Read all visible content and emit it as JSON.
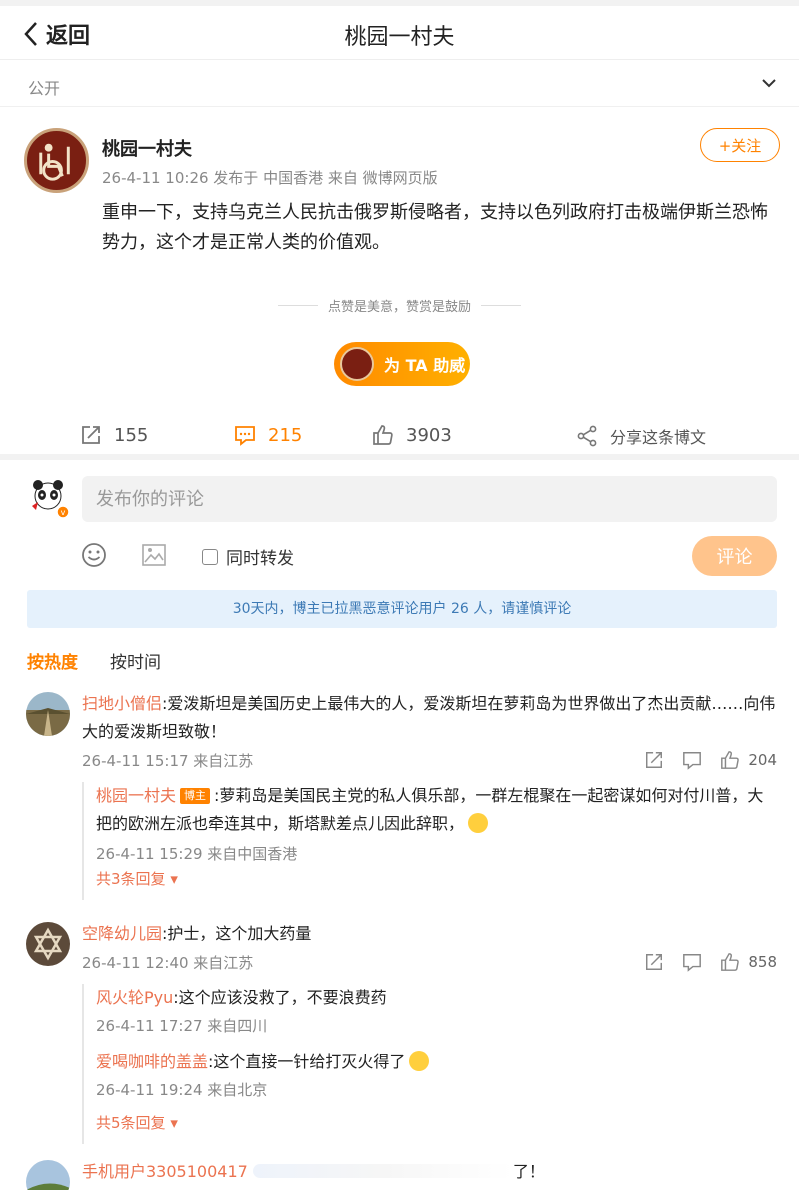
{
  "header": {
    "back_label": "返回",
    "title": "桃园一村夫"
  },
  "visibility": {
    "label": "公开"
  },
  "post": {
    "author": "桃园一村夫",
    "meta": "26-4-11 10:26 发布于 中国香港  来自 微博网页版",
    "follow_label": "+关注",
    "text": "重申一下，支持乌克兰人民抗击俄罗斯侵略者，支持以色列政府打击极端伊斯兰恐怖势力，这个才是正常人类的价值观。",
    "reward_tip": "点赞是美意，赞赏是鼓励",
    "reward_button": "为 TA 助威"
  },
  "actions": {
    "reposts": "155",
    "comments": "215",
    "likes": "3903",
    "share": "分享这条博文"
  },
  "composer": {
    "placeholder": "发布你的评论",
    "repost_label": "同时转发",
    "submit_label": "评论"
  },
  "notice": "30天内，博主已拉黑恶意评论用户 26 人，请谨慎评论",
  "sort": {
    "hot": "按热度",
    "time": "按时间"
  },
  "comments": [
    {
      "user": "扫地小僧侣",
      "text": ":爱泼斯坦是美国历史上最伟大的人，爱泼斯坦在萝莉岛为世界做出了杰出贡献……向伟大的爱泼斯坦致敬！",
      "time": "26-4-11 15:17 来自江苏",
      "likes": "204",
      "replies": [
        {
          "user": "桃园一村夫",
          "badge": "博主",
          "text": ":萝莉岛是美国民主党的私人俱乐部，一群左棍聚在一起密谋如何对付川普，大把的欧洲左派也牵连其中，斯塔默差点儿因此辞职，",
          "time": "26-4-11 15:29 来自中国香港"
        }
      ],
      "more": "共3条回复"
    },
    {
      "user": "空降幼儿园",
      "text": ":护士，这个加大药量",
      "time": "26-4-11 12:40 来自江苏",
      "likes": "858",
      "replies": [
        {
          "user": "风火轮Pyu",
          "text": ":这个应该没救了，不要浪费药",
          "time": "26-4-11 17:27 来自四川"
        },
        {
          "user": "爱喝咖啡的盖盖",
          "text": ":这个直接一针给打灭火得了",
          "time": "26-4-11 19:24 来自北京"
        }
      ],
      "more": "共5条回复"
    },
    {
      "user": "手机用户3305100417",
      "text": "了！"
    }
  ],
  "colors": {
    "accent": "#ff8200",
    "username": "#eb7350",
    "notice_bg": "#e5f1fc",
    "notice_text": "#3d7ab5"
  }
}
